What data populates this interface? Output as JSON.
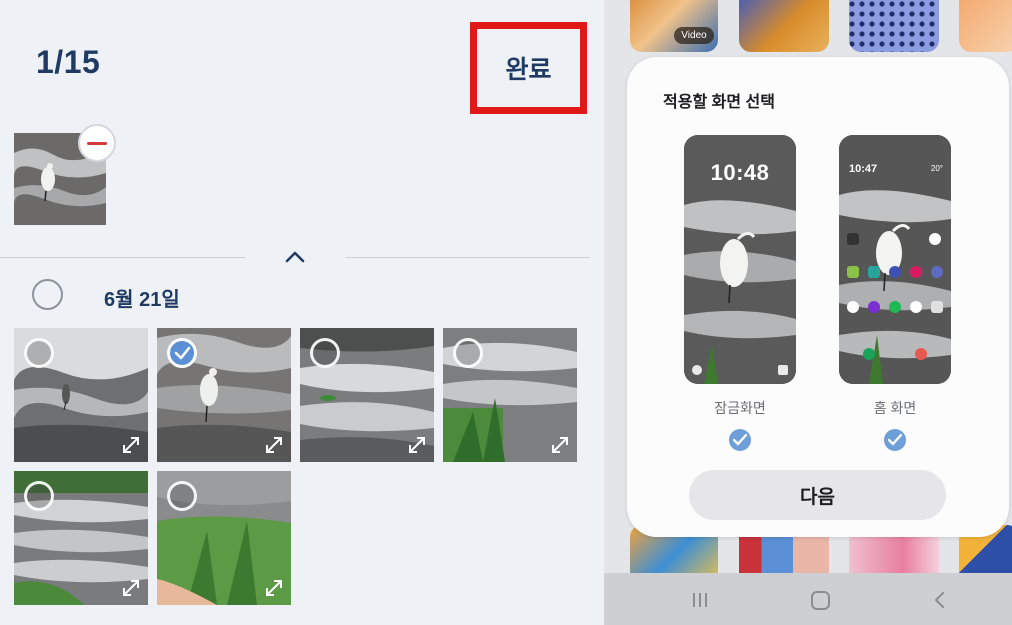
{
  "header": {
    "counter": "1/15",
    "done_label": "완료"
  },
  "selection_tray": {
    "remove_icon": "minus-circle-icon"
  },
  "gallery": {
    "date_label": "6월 21일",
    "photos": [
      {
        "selected": false
      },
      {
        "selected": true
      },
      {
        "selected": false
      },
      {
        "selected": false
      },
      {
        "selected": false
      },
      {
        "selected": false
      }
    ]
  },
  "background_tiles": {
    "video_label": "Video"
  },
  "sheet": {
    "title": "적용할 화면 선택",
    "lock_screen": {
      "label": "잠금화면",
      "time": "10:48",
      "checked": true
    },
    "home_screen": {
      "label": "홈 화면",
      "time": "10:47",
      "weather": "20°",
      "checked": true
    },
    "next_label": "다음"
  },
  "nav": {
    "recent_icon": "recent-apps-icon",
    "home_icon": "home-icon",
    "back_icon": "back-icon"
  },
  "colors": {
    "accent": "#1f3b63",
    "highlight": "#e01818",
    "check_blue": "#5b8fd6"
  }
}
